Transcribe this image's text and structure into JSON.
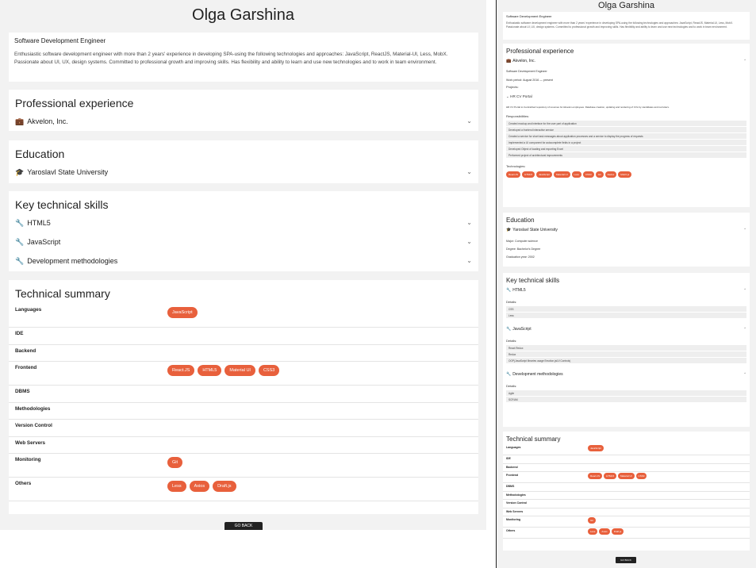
{
  "profile": {
    "name": "Olga Garshina",
    "subtitle": "Software Development Engineer",
    "description": "Enthusiastic software development engineer with more than 2 years' experience in developing SPA-using the following technologies and approaches: JavaScript, ReactJS, Material-UI, Less, MobX. Passionate about UI, UX, design systems. Committed to professional growth and improving skills. Has flexibility and ability to learn and use new technologies and to work in team environment."
  },
  "experience": {
    "title": "Professional experience",
    "company": "Akvelon, Inc.",
    "position": "Software Development Engineer",
    "work_period": "Work period: August 2016 — present",
    "projects_label": "Projects:",
    "project_name": "HR CV Portal",
    "project_desc": "HR CV Portal to Centralized repository of resumes for Akvelon employees. Database creation, updating and rendering of CVs by candidates and recruiters.",
    "responsibilities_label": "Responsibilities:",
    "responsibilities": [
      "Created mockup and interface for the user part of application",
      "Developed a frontend interactive service",
      "Created a service for short task messages about application processes and a service to display the progress of requests",
      "Implemented a UI component for autocomplete fields in a project",
      "Developed Object of loading and exporting Excel",
      "Performed project of architectural improvements"
    ],
    "technologies_label": "Technologies:",
    "technologies": [
      "React.JS",
      "HTML5",
      "JavaScript",
      "Material UI",
      "Less",
      "CSS3",
      "Git",
      "Redux",
      "MobX.js"
    ]
  },
  "education": {
    "title": "Education",
    "university": "Yaroslavl State University",
    "major": "Major: Computer science",
    "degree": "Degree: Bachelor's Degree",
    "graduation": "Graduation year: 2002"
  },
  "skills": {
    "title": "Key technical skills",
    "details_label": "Details:",
    "items": [
      {
        "name": "HTML5",
        "details": [
          "CSS",
          "Less"
        ]
      },
      {
        "name": "JavaScript",
        "details": [
          "React Redux",
          "Redux",
          "OOP(JavaScript libraries usage Emotion.js/UI Controls)"
        ]
      },
      {
        "name": "Development methodologies",
        "details": [
          "Agile",
          "SCRUM"
        ]
      }
    ]
  },
  "technical_summary": {
    "title": "Technical summary",
    "rows": [
      {
        "label": "Languages",
        "chips": [
          "JavaScript"
        ]
      },
      {
        "label": "IDE",
        "chips": []
      },
      {
        "label": "Backend",
        "chips": []
      },
      {
        "label": "Frontend",
        "chips": [
          "React.JS",
          "HTML5",
          "Material UI",
          "CSS3"
        ]
      },
      {
        "label": "DBMS",
        "chips": []
      },
      {
        "label": "Methodologies",
        "chips": []
      },
      {
        "label": "Version Control",
        "chips": []
      },
      {
        "label": "Web Servers",
        "chips": []
      },
      {
        "label": "Monitoring",
        "chips": [
          "Git"
        ]
      },
      {
        "label": "Others",
        "chips": [
          "Less",
          "Axios",
          "Draft.js"
        ]
      }
    ]
  },
  "go_back_label": "GO BACK",
  "colors": {
    "accent": "#e8603c",
    "background": "#f2f2f2",
    "button": "#222222"
  },
  "icons": {
    "company": "briefcase-icon",
    "university": "graduation-cap-icon",
    "skill": "wrench-icon",
    "expand": "chevron-down-icon",
    "collapse": "chevron-up-icon"
  }
}
